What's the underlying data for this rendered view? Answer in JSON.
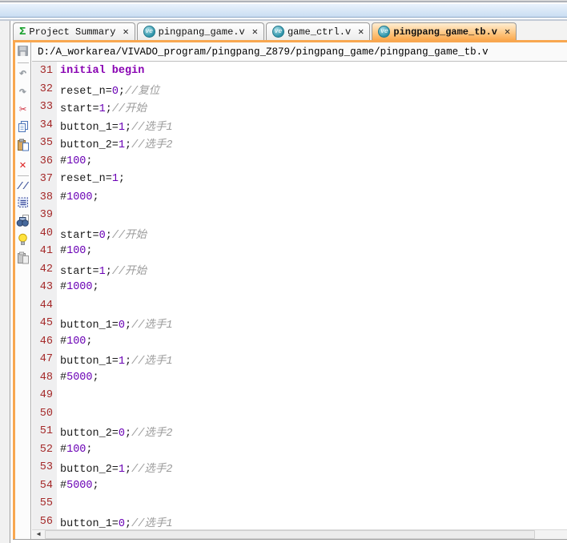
{
  "tab_bar": {
    "close_glyph": "✕",
    "tabs": [
      {
        "label": "Project Summary",
        "icon": "sigma-icon",
        "active": false
      },
      {
        "label": "pingpang_game.v",
        "icon": "verilog-file-icon",
        "active": false
      },
      {
        "label": "game_ctrl.v",
        "icon": "verilog-file-icon",
        "active": false
      },
      {
        "label": "pingpang_game_tb.v",
        "icon": "verilog-file-icon",
        "active": true
      }
    ]
  },
  "path_bar": {
    "file_path": "D:/A_workarea/VIVADO_program/pingpang_Z879/pingpang_game/pingpang_game_tb.v"
  },
  "toolbar": {
    "items": [
      {
        "name": "save",
        "icon": "floppy-icon",
        "disabled": true
      },
      {
        "name": "separator"
      },
      {
        "name": "undo",
        "icon": "undo-icon",
        "glyph": "↶",
        "disabled": true
      },
      {
        "name": "redo",
        "icon": "redo-icon",
        "glyph": "↷",
        "disabled": true
      },
      {
        "name": "cut",
        "icon": "scissors-icon",
        "glyph": "✂"
      },
      {
        "name": "copy",
        "icon": "copy-icon"
      },
      {
        "name": "paste",
        "icon": "paste-icon"
      },
      {
        "name": "delete",
        "icon": "delete-x-icon",
        "glyph": "✕"
      },
      {
        "name": "separator"
      },
      {
        "name": "toggle-comment",
        "icon": "comment-slashes-icon",
        "glyph": "//"
      },
      {
        "name": "block-select",
        "icon": "dashed-block-icon"
      },
      {
        "name": "find-replace",
        "icon": "binoculars-icon"
      },
      {
        "name": "tips",
        "icon": "lightbulb-icon"
      },
      {
        "name": "paste-special",
        "icon": "clipboard-gray-icon",
        "disabled": true
      }
    ]
  },
  "editor": {
    "language": "verilog",
    "first_line_number": 31,
    "lines": [
      {
        "no": 31,
        "segs": [
          [
            "k",
            "initial begin"
          ]
        ]
      },
      {
        "no": 32,
        "segs": [
          [
            "p",
            "reset_n="
          ],
          [
            "n",
            "0"
          ],
          [
            "p",
            ";"
          ],
          [
            "c",
            "//复位"
          ]
        ]
      },
      {
        "no": 33,
        "segs": [
          [
            "p",
            "start="
          ],
          [
            "n",
            "1"
          ],
          [
            "p",
            ";"
          ],
          [
            "c",
            "//开始"
          ]
        ]
      },
      {
        "no": 34,
        "segs": [
          [
            "p",
            "button_1="
          ],
          [
            "n",
            "1"
          ],
          [
            "p",
            ";"
          ],
          [
            "c",
            "//选手1"
          ]
        ]
      },
      {
        "no": 35,
        "segs": [
          [
            "p",
            "button_2="
          ],
          [
            "n",
            "1"
          ],
          [
            "p",
            ";"
          ],
          [
            "c",
            "//选手2"
          ]
        ]
      },
      {
        "no": 36,
        "segs": [
          [
            "p",
            "#"
          ],
          [
            "n",
            "100"
          ],
          [
            "p",
            ";"
          ]
        ]
      },
      {
        "no": 37,
        "segs": [
          [
            "p",
            "reset_n="
          ],
          [
            "n",
            "1"
          ],
          [
            "p",
            ";"
          ]
        ]
      },
      {
        "no": 38,
        "segs": [
          [
            "p",
            "#"
          ],
          [
            "n",
            "1000"
          ],
          [
            "p",
            ";"
          ]
        ]
      },
      {
        "no": 39,
        "segs": []
      },
      {
        "no": 40,
        "segs": [
          [
            "p",
            "start="
          ],
          [
            "n",
            "0"
          ],
          [
            "p",
            ";"
          ],
          [
            "c",
            "//开始"
          ]
        ]
      },
      {
        "no": 41,
        "segs": [
          [
            "p",
            "#"
          ],
          [
            "n",
            "100"
          ],
          [
            "p",
            ";"
          ]
        ]
      },
      {
        "no": 42,
        "segs": [
          [
            "p",
            "start="
          ],
          [
            "n",
            "1"
          ],
          [
            "p",
            ";"
          ],
          [
            "c",
            "//开始"
          ]
        ]
      },
      {
        "no": 43,
        "segs": [
          [
            "p",
            "#"
          ],
          [
            "n",
            "1000"
          ],
          [
            "p",
            ";"
          ]
        ]
      },
      {
        "no": 44,
        "segs": []
      },
      {
        "no": 45,
        "segs": [
          [
            "p",
            "button_1="
          ],
          [
            "n",
            "0"
          ],
          [
            "p",
            ";"
          ],
          [
            "c",
            "//选手1"
          ]
        ]
      },
      {
        "no": 46,
        "segs": [
          [
            "p",
            "#"
          ],
          [
            "n",
            "100"
          ],
          [
            "p",
            ";"
          ]
        ]
      },
      {
        "no": 47,
        "segs": [
          [
            "p",
            "button_1="
          ],
          [
            "n",
            "1"
          ],
          [
            "p",
            ";"
          ],
          [
            "c",
            "//选手1"
          ]
        ]
      },
      {
        "no": 48,
        "segs": [
          [
            "p",
            "#"
          ],
          [
            "n",
            "5000"
          ],
          [
            "p",
            ";"
          ]
        ]
      },
      {
        "no": 49,
        "segs": []
      },
      {
        "no": 50,
        "segs": []
      },
      {
        "no": 51,
        "segs": [
          [
            "p",
            "button_2="
          ],
          [
            "n",
            "0"
          ],
          [
            "p",
            ";"
          ],
          [
            "c",
            "//选手2"
          ]
        ]
      },
      {
        "no": 52,
        "segs": [
          [
            "p",
            "#"
          ],
          [
            "n",
            "100"
          ],
          [
            "p",
            ";"
          ]
        ]
      },
      {
        "no": 53,
        "segs": [
          [
            "p",
            "button_2="
          ],
          [
            "n",
            "1"
          ],
          [
            "p",
            ";"
          ],
          [
            "c",
            "//选手2"
          ]
        ]
      },
      {
        "no": 54,
        "segs": [
          [
            "p",
            "#"
          ],
          [
            "n",
            "5000"
          ],
          [
            "p",
            ";"
          ]
        ]
      },
      {
        "no": 55,
        "segs": []
      },
      {
        "no": 56,
        "segs": [
          [
            "p",
            "button_1="
          ],
          [
            "n",
            "0"
          ],
          [
            "p",
            ";"
          ],
          [
            "c",
            "//选手1"
          ]
        ]
      }
    ]
  },
  "scrollbar": {
    "left_arrow_glyph": "◀"
  },
  "colors": {
    "accent_orange": "#f8a750",
    "keyword": "#8800b2",
    "number": "#6a00b5",
    "comment": "#9b9b9b",
    "line_number": "#a52a2a",
    "verilog_icon": "#2e93a8",
    "sigma_green": "#18a02c"
  }
}
